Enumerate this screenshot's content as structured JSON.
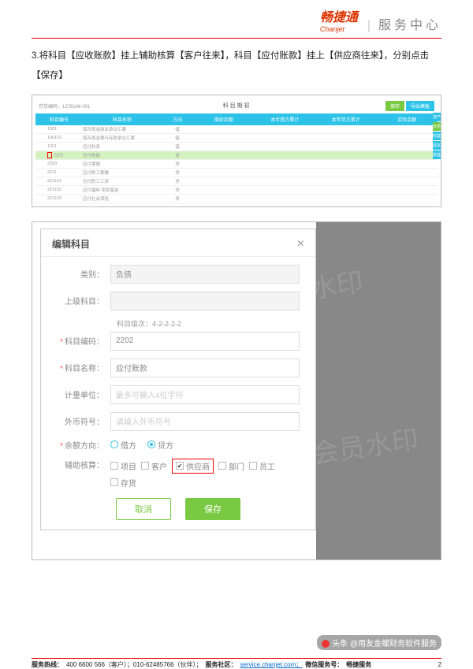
{
  "header": {
    "brand_cn": "畅捷通",
    "brand_en": "Chanjet",
    "service": "服务中心"
  },
  "instruction": "3.将科目【应收账款】挂上辅助核算【客户往来】，科目【应付账款】挂上【供应商往来】，分别点击【保存】",
  "screenshot1": {
    "topbar_code": "存货编码：1278146-001",
    "title": "科目期初",
    "btn1": "保存",
    "btn2": "导出模板",
    "headers": [
      "科目编号",
      "科目名称",
      "方向",
      "期初余额",
      "本年借方累计",
      "本年贷方累计",
      "实际余额"
    ],
    "rows": [
      {
        "code": "1001",
        "name": "库存现金商业承兑汇票",
        "dir": "借"
      },
      {
        "code": "100102",
        "name": "库存现金银行存款承兑汇票",
        "dir": "借"
      },
      {
        "code": "1201",
        "name": "应付利息",
        "dir": "借"
      },
      {
        "code": "2202",
        "name": "应付账款",
        "dir": "贷",
        "highlight": true,
        "redbox": true
      },
      {
        "code": "2203",
        "name": "应付票据",
        "dir": "贷"
      },
      {
        "code": "2211",
        "name": "应付职工薪酬",
        "dir": "贷"
      },
      {
        "code": "221101",
        "name": "应付职工工资",
        "dir": "贷"
      },
      {
        "code": "221102",
        "name": "应付福利 奖励基金",
        "dir": "贷"
      },
      {
        "code": "221103",
        "name": "应付社会保险",
        "dir": "贷"
      }
    ],
    "side_tags": [
      "资产",
      "负债",
      "权益",
      "成本",
      "损益"
    ]
  },
  "dialog": {
    "title": "编辑科目",
    "fields": {
      "type_label": "类别：",
      "type_value": "负债",
      "parent_label": "上级科目：",
      "parent_value": "",
      "level_hint": "科目级次：4-2-2-2-2",
      "code_label": "科目编码：",
      "code_value": "2202",
      "name_label": "科目名称：",
      "name_value": "应付账款",
      "unit_label": "计量单位：",
      "unit_placeholder": "最多可输入4位字符",
      "currency_label": "外币符号：",
      "currency_placeholder": "请输入外币符号",
      "balance_label": "余额方向：",
      "debit": "借方",
      "credit": "贷方",
      "aux_label": "辅助核算：",
      "aux_opts": {
        "project": "项目",
        "customer": "客户",
        "supplier": "供应商",
        "dept": "部门",
        "employee": "员工",
        "inventory": "存货"
      }
    },
    "buttons": {
      "cancel": "取消",
      "save": "保存"
    }
  },
  "watermark": "非会员水印",
  "footer": {
    "hotline_label": "服务热线：",
    "hotline": "400 6600 566（客户）；010-62485766（伙伴）；",
    "community_label": "服务社区：",
    "community_link": "service.chanjet.com；",
    "wechat_label": "微信服务号：",
    "wechat": "畅捷服务",
    "page": "2"
  },
  "credit": "头条 @用友金蝶财务软件服务"
}
